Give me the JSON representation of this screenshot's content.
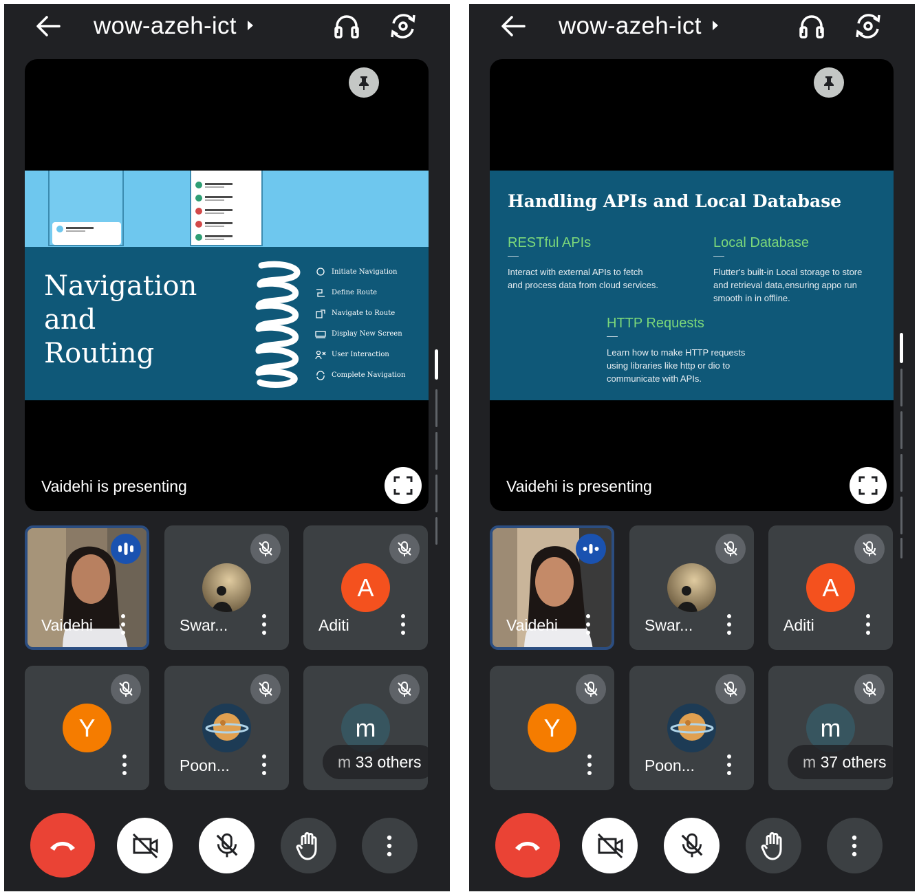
{
  "screens": [
    {
      "meeting_code": "wow-azeh-ict",
      "presenting_text": "Vaidehi is presenting",
      "slide": {
        "title_lines": [
          "Navigation",
          "and",
          "Routing"
        ],
        "steps": [
          "Initiate Navigation",
          "Define Route",
          "Navigate to Route",
          "Display New Screen",
          "User Interaction",
          "Complete Navigation"
        ]
      },
      "participants": [
        {
          "name": "Vaidehi",
          "avatar_letter": ""
        },
        {
          "name": "Swar...",
          "avatar_letter": ""
        },
        {
          "name": "Aditi",
          "avatar_letter": "A"
        },
        {
          "name": "",
          "avatar_letter": "Y"
        },
        {
          "name": "Poon...",
          "avatar_letter": ""
        },
        {
          "name": "m",
          "avatar_letter": "m"
        }
      ],
      "others_count": "33 others"
    },
    {
      "meeting_code": "wow-azeh-ict",
      "presenting_text": "Vaidehi is presenting",
      "slide": {
        "title": "Handling APIs and Local Database",
        "sections": [
          {
            "heading": "RESTful APIs",
            "body": [
              "Interact with external APIs to fetch",
              "and process data from cloud services."
            ]
          },
          {
            "heading": "Local Database",
            "body": [
              "Flutter's built-in Local storage to store",
              "and retrieval data,ensuring appo run",
              "smooth in in offline."
            ]
          },
          {
            "heading": "HTTP Requests",
            "body": [
              "Learn how to make HTTP  requests",
              "using libraries like http or dio to",
              "communicate with APIs."
            ]
          }
        ]
      },
      "participants": [
        {
          "name": "Vaidehi",
          "avatar_letter": ""
        },
        {
          "name": "Swar...",
          "avatar_letter": ""
        },
        {
          "name": "Aditi",
          "avatar_letter": "A"
        },
        {
          "name": "",
          "avatar_letter": "Y"
        },
        {
          "name": "Poon...",
          "avatar_letter": ""
        },
        {
          "name": "m",
          "avatar_letter": "m"
        }
      ],
      "others_count": "37 others"
    }
  ],
  "icons": {
    "back": "arrow-left-icon",
    "audio": "headphones-icon",
    "camera_switch": "flip-camera-icon",
    "pin": "pin-icon",
    "fullscreen": "fullscreen-icon",
    "mic_off": "mic-off-icon",
    "speaking": "audio-level-icon",
    "more": "more-vert-icon",
    "end_call": "call-end-icon",
    "video_off": "videocam-off-icon",
    "hand": "raise-hand-icon"
  },
  "colors": {
    "background": "#202124",
    "tile": "#3c4043",
    "end_call": "#ea4335",
    "active_speaker_border": "#2b4d80",
    "avatar_aditi": "#f4511e",
    "avatar_y": "#f57c00",
    "avatar_m": "#37555f",
    "slide_bg": "#0f5878",
    "slide_accent": "#7cd87a"
  }
}
